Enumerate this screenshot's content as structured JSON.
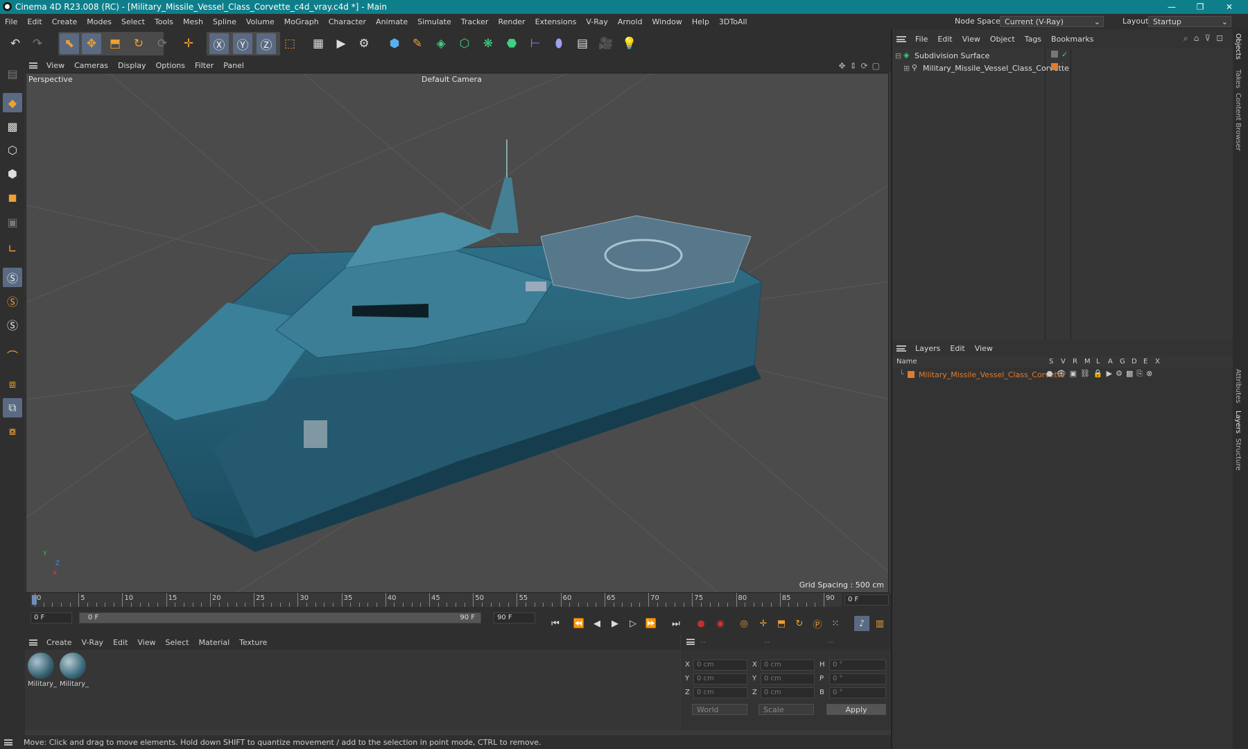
{
  "window": {
    "title": "Cinema 4D R23.008 (RC) - [Military_Missile_Vessel_Class_Corvette_c4d_vray.c4d *] - Main",
    "minimize": "—",
    "maximize": "❐",
    "close": "✕"
  },
  "menubar": {
    "items": [
      "File",
      "Edit",
      "Create",
      "Modes",
      "Select",
      "Tools",
      "Mesh",
      "Spline",
      "Volume",
      "MoGraph",
      "Character",
      "Animate",
      "Simulate",
      "Tracker",
      "Render",
      "Extensions",
      "V-Ray",
      "Arnold",
      "Window",
      "Help",
      "3DToAll"
    ],
    "node_space_label": "Node Space:",
    "node_space_value": "Current (V-Ray)",
    "layout_label": "Layout:",
    "layout_value": "Startup"
  },
  "viewport": {
    "menu": [
      "View",
      "Cameras",
      "Display",
      "Options",
      "Filter",
      "Panel"
    ],
    "label": "Perspective",
    "camera": "Default Camera",
    "grid_spacing": "Grid Spacing : 500 cm",
    "axis_y": "Y",
    "axis_z": "Z",
    "axis_x": "X"
  },
  "timeline": {
    "ticks": [
      "0",
      "5",
      "10",
      "15",
      "20",
      "25",
      "30",
      "35",
      "40",
      "45",
      "50",
      "55",
      "60",
      "65",
      "70",
      "75",
      "80",
      "85",
      "90"
    ],
    "current_frame": "0 F",
    "start_field": "0 F",
    "range_start": "0 F",
    "range_end": "90 F",
    "end_field": "90 F"
  },
  "materials": {
    "menu": [
      "Create",
      "V-Ray",
      "Edit",
      "View",
      "Select",
      "Material",
      "Texture"
    ],
    "items": [
      {
        "label": "Military_"
      },
      {
        "label": "Military_"
      }
    ]
  },
  "coords": {
    "headers": [
      "--",
      "--",
      "--"
    ],
    "rows": [
      {
        "a": "X",
        "av": "0 cm",
        "b": "X",
        "bv": "0 cm",
        "c": "H",
        "cv": "0 °"
      },
      {
        "a": "Y",
        "av": "0 cm",
        "b": "Y",
        "bv": "0 cm",
        "c": "P",
        "cv": "0 °"
      },
      {
        "a": "Z",
        "av": "0 cm",
        "b": "Z",
        "bv": "0 cm",
        "c": "B",
        "cv": "0 °"
      }
    ],
    "world": "World",
    "scale": "Scale",
    "apply": "Apply"
  },
  "status": {
    "text": "Move: Click and drag to move elements. Hold down SHIFT to quantize movement / add to the selection in point mode, CTRL to remove."
  },
  "objects": {
    "menu": [
      "File",
      "Edit",
      "View",
      "Object",
      "Tags",
      "Bookmarks"
    ],
    "tree": [
      {
        "name": "Subdivision Surface"
      },
      {
        "name": "Military_Missile_Vessel_Class_Corvette"
      }
    ]
  },
  "layers": {
    "menu": [
      "Layers",
      "Edit",
      "View"
    ],
    "name_header": "Name",
    "flags": [
      "S",
      "V",
      "R",
      "M",
      "L",
      "A",
      "G",
      "D",
      "E",
      "X"
    ],
    "rows": [
      {
        "name": "Military_Missile_Vessel_Class_Corvette"
      }
    ]
  },
  "side_tabs": [
    "Objects",
    "Takes",
    "Content Browser",
    "Attributes",
    "Layers",
    "Structure"
  ],
  "colors": {
    "titlebar": "#0e7f8a",
    "accent_orange": "#e07b2c",
    "selected_tool": "#5a6a82"
  }
}
